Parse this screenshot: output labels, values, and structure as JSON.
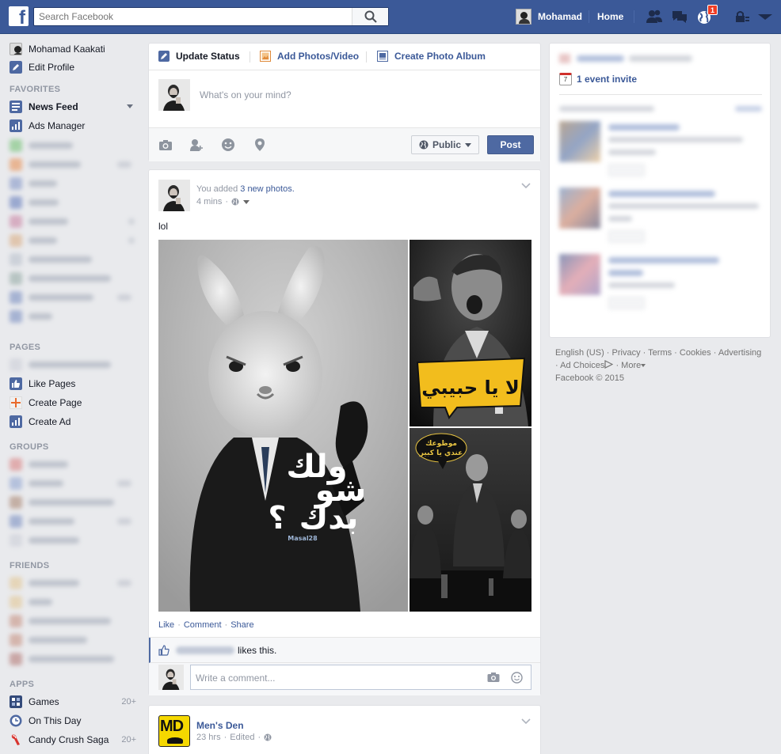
{
  "topbar": {
    "search_placeholder": "Search Facebook",
    "profile_name": "Mohamad",
    "home_label": "Home",
    "notification_count": "1"
  },
  "sidebar": {
    "user": {
      "name": "Mohamad Kaakati",
      "edit_profile": "Edit Profile"
    },
    "sections": {
      "favorites": "FAVORITES",
      "pages": "PAGES",
      "groups": "GROUPS",
      "friends": "FRIENDS",
      "apps": "APPS"
    },
    "favorites": [
      {
        "label": "News Feed",
        "bold": true
      },
      {
        "label": "Ads Manager"
      }
    ],
    "pages": [
      {
        "label": "Like Pages"
      },
      {
        "label": "Create Page"
      },
      {
        "label": "Create Ad"
      }
    ],
    "apps": [
      {
        "label": "Games",
        "count": "20+"
      },
      {
        "label": "On This Day",
        "count": ""
      },
      {
        "label": "Candy Crush Saga",
        "count": "20+"
      }
    ]
  },
  "composer": {
    "tabs": [
      "Update Status",
      "Add Photos/Video",
      "Create Photo Album"
    ],
    "placeholder": "What's on your mind?",
    "privacy": "Public",
    "post_label": "Post"
  },
  "story": {
    "meta_prefix": "You added ",
    "meta_link": "3 new photos.",
    "time": "4 mins",
    "text": "lol",
    "actions": [
      "Like",
      "Comment",
      "Share"
    ],
    "likes_suffix": "likes this.",
    "comment_placeholder": "Write a comment...",
    "photo_captions": {
      "big": [
        "ولك",
        "شو",
        "بدك",
        "؟"
      ],
      "big_tag": "Masal28",
      "r1": "لا يا حبيبي",
      "r2": [
        "موظوعك",
        "عندي يا كبير"
      ]
    }
  },
  "story2": {
    "logo_text": "MD",
    "page_name": "Men's Den",
    "time": "23 hrs",
    "edited": "Edited"
  },
  "right": {
    "event_day": "7",
    "event_text": "1 event invite"
  },
  "footer": {
    "links": [
      "English (US)",
      "Privacy",
      "Terms",
      "Cookies",
      "Advertising",
      "Ad Choices",
      "More"
    ],
    "copyright": "Facebook © 2015"
  },
  "colors": {
    "brand": "#3b5998",
    "background": "#e9eaed",
    "link": "#3b5998",
    "notification": "#f03d25"
  }
}
